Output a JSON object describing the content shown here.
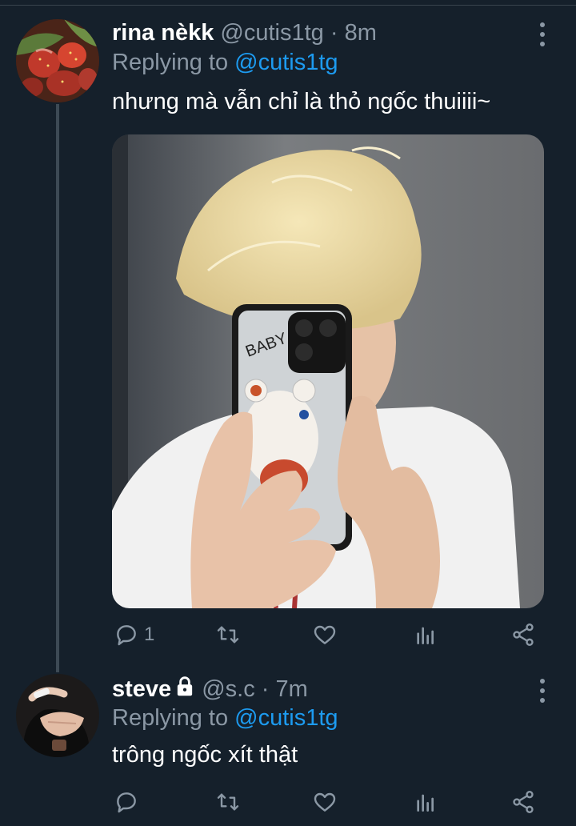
{
  "tweets": [
    {
      "name": "rina nèkk",
      "handle": "@cutis1tg",
      "dot": "·",
      "time": "8m",
      "reply_prefix": "Replying to",
      "reply_mention": "@cutis1tg",
      "text": "nhưng mà vẫn chỉ là thỏ ngốc thuiiii~",
      "image_text": "BABY",
      "reply_count": "1",
      "retweet_count": "",
      "like_count": ""
    },
    {
      "name": "steve",
      "handle": "@s.c",
      "dot": "·",
      "time": "7m",
      "reply_prefix": "Replying to",
      "reply_mention": "@cutis1tg",
      "text": "trông ngốc xít thật",
      "reply_count": "",
      "retweet_count": "",
      "like_count": ""
    }
  ],
  "colors": {
    "background": "#15202b",
    "secondary_text": "#8b98a5",
    "accent": "#1d9bf0"
  },
  "icons": [
    "reply-icon",
    "retweet-icon",
    "like-icon",
    "analytics-icon",
    "share-icon",
    "more-icon",
    "lock-icon"
  ]
}
